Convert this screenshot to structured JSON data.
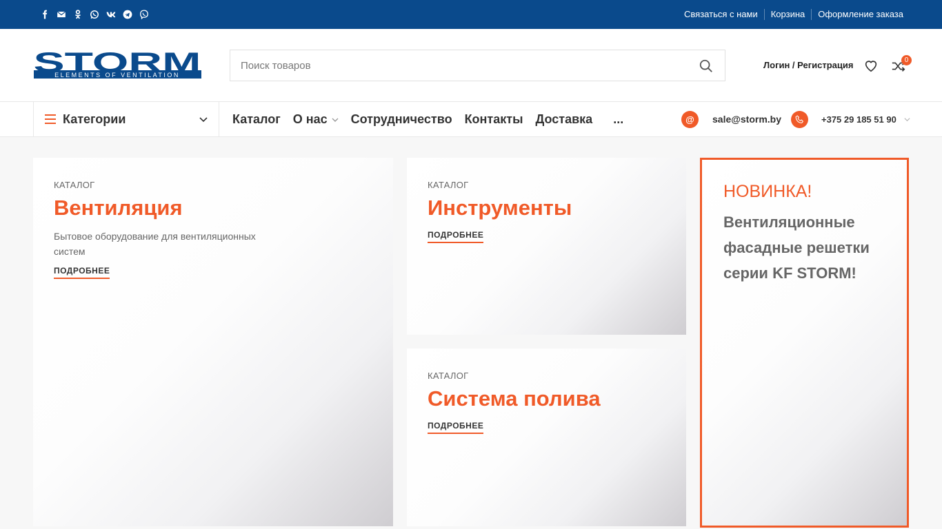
{
  "topbar": {
    "social_icons": [
      "facebook-icon",
      "email-icon",
      "odnoklassniki-icon",
      "whatsapp-icon",
      "vk-icon",
      "telegram-icon",
      "viber-icon"
    ],
    "links": [
      "Связаться с нами",
      "Корзина",
      "Оформление заказа"
    ]
  },
  "header": {
    "logo_text": "STORM",
    "logo_tagline": "ELEMENTS OF VENTILATION",
    "search_placeholder": "Поиск товаров",
    "login_label": "Логин / Регистрация",
    "compare_count": "0"
  },
  "nav": {
    "categories_label": "Категории",
    "items": [
      "Каталог",
      "О нас",
      "Сотрудничество",
      "Контакты",
      "Доставка"
    ],
    "more_label": "...",
    "email": "sale@storm.by",
    "phone": "+375 29 185 51 90"
  },
  "cards": [
    {
      "kicker": "КАТАЛОГ",
      "title": "Вентиляция",
      "description": "Бытовое оборудование для вентиляционных систем",
      "more_label": "ПОДРОБНЕЕ"
    },
    {
      "kicker": "КАТАЛОГ",
      "title": "Инструменты",
      "more_label": "ПОДРОБНЕЕ"
    },
    {
      "kicker": "КАТАЛОГ",
      "title": "Система полива",
      "more_label": "ПОДРОБНЕЕ"
    }
  ],
  "promo": {
    "title": "НОВИНКА!",
    "text": "Вентиляционные фасадные решетки серии KF STORM!"
  },
  "colors": {
    "topbar_bg": "#0a4a8c",
    "accent": "#f05a28",
    "logo_blue": "#0a4a8c"
  }
}
